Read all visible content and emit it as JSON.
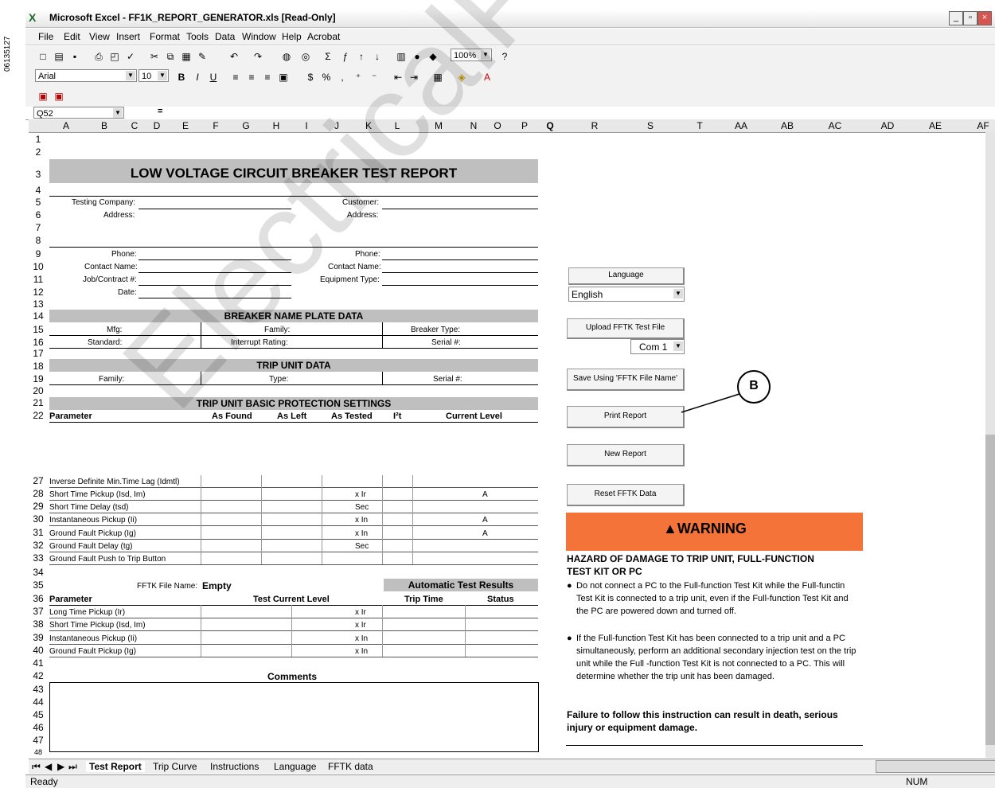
{
  "doc_id": "06135127",
  "window": {
    "title": "Microsoft Excel - FF1K_REPORT_GENERATOR.xls [Read-Only]",
    "icon": "excel-icon"
  },
  "menu": [
    "File",
    "Edit",
    "View",
    "Insert",
    "Format",
    "Tools",
    "Data",
    "Window",
    "Help",
    "Acrobat"
  ],
  "toolbar": {
    "zoom": "100%"
  },
  "format": {
    "font": "Arial",
    "size": "10"
  },
  "formula": {
    "namebox": "Q52",
    "eq": "="
  },
  "columns": [
    "A",
    "B",
    "C",
    "D",
    "E",
    "F",
    "G",
    "H",
    "I",
    "J",
    "K",
    "L",
    "M",
    "N",
    "O",
    "P",
    "Q",
    "R",
    "S",
    "T",
    "AA",
    "AB",
    "AC",
    "AD",
    "AE",
    "AF"
  ],
  "rows": [
    "1",
    "2",
    "3",
    "4",
    "5",
    "6",
    "7",
    "8",
    "9",
    "10",
    "11",
    "12",
    "13",
    "14",
    "15",
    "16",
    "17",
    "18",
    "19",
    "20",
    "21",
    "22",
    "27",
    "28",
    "29",
    "30",
    "31",
    "32",
    "33",
    "34",
    "35",
    "36",
    "37",
    "38",
    "39",
    "40",
    "41",
    "42",
    "43",
    "44",
    "45",
    "46",
    "47",
    "48"
  ],
  "report": {
    "title": "LOW VOLTAGE CIRCUIT BREAKER TEST REPORT",
    "left_labels": [
      "Testing Company:",
      "Address:",
      "Phone:",
      "Contact Name:",
      "Job/Contract #:",
      "Date:"
    ],
    "right_labels": [
      "Customer:",
      "Address:",
      "Phone:",
      "Contact Name:",
      "Equipment Type:"
    ],
    "nameplate_title": "BREAKER NAME PLATE DATA",
    "nameplate": {
      "mfg": "Mfg:",
      "family": "Family:",
      "breaker_type": "Breaker Type:",
      "standard": "Standard:",
      "interrupt": "Interrupt Rating:",
      "serial": "Serial #:"
    },
    "tripunit_title": "TRIP UNIT DATA",
    "tripunit": {
      "family": "Family:",
      "type": "Type:",
      "serial": "Serial #:"
    },
    "settings_title": "TRIP UNIT BASIC PROTECTION SETTINGS",
    "settings_headers": [
      "Parameter",
      "As Found",
      "As Left",
      "As Tested",
      "I²t",
      "Current Level"
    ],
    "settings_rows": [
      {
        "p": "Inverse Definite Min.Time Lag (Idmtl)",
        "u": "",
        "c": ""
      },
      {
        "p": "Short Time Pickup (Isd, Im)",
        "u": "x Ir",
        "c": "A"
      },
      {
        "p": "Short Time Delay (tsd)",
        "u": "Sec",
        "c": ""
      },
      {
        "p": "Instantaneous Pickup (Ii)",
        "u": "x In",
        "c": "A"
      },
      {
        "p": "Ground Fault Pickup (Ig)",
        "u": "x In",
        "c": "A"
      },
      {
        "p": "Ground Fault Delay (tg)",
        "u": "Sec",
        "c": ""
      },
      {
        "p": "Ground Fault Push to Trip Button",
        "u": "",
        "c": ""
      }
    ],
    "file_label": "FFTK File Name:",
    "file_value": "Empty",
    "auto_title": "Automatic Test Results",
    "auto_headers": [
      "Parameter",
      "Test Current Level",
      "Trip Time",
      "Status"
    ],
    "auto_rows": [
      {
        "p": "Long Time Pickup (Ir)",
        "u": "x Ir"
      },
      {
        "p": "Short Time Pickup (Isd, Im)",
        "u": "x Ir"
      },
      {
        "p": "Instantaneous Pickup (Ii)",
        "u": "x In"
      },
      {
        "p": "Ground Fault Pickup (Ig)",
        "u": "x In"
      }
    ],
    "comments": "Comments"
  },
  "side": {
    "language_label": "Language",
    "language_value": "English",
    "upload": "Upload FFTK Test File",
    "com": "Com 1",
    "save": "Save Using 'FFTK File Name'",
    "print": "Print Report",
    "callout": "B",
    "new": "New Report",
    "reset": "Reset FFTK Data",
    "warning": "WARNING",
    "hazard": "HAZARD OF DAMAGE TO TRIP UNIT, FULL-FUNCTION TEST KIT OR PC",
    "bullet1": "Do not connect a PC to the Full-function Test Kit while the Full-functin Test Kit is connected to a trip unit, even if the Full-function Test Kit and the PC are powered down and turned off.",
    "bullet2": "If the Full-function Test Kit has been connected to a trip unit and a PC simultaneously, perform an additional secondary injection test on the trip unit while the Full -function Test Kit is not connected to a PC.  This will determine whether the trip unit has been damaged.",
    "failure": "Failure to follow this instruction can result in death, serious injury or equipment damage."
  },
  "tabs": [
    "Test Report",
    "Trip Curve",
    "Instructions",
    "Language",
    "FFTK data"
  ],
  "status": {
    "ready": "Ready",
    "num": "NUM"
  },
  "watermark": "ElectricalPartManuals"
}
